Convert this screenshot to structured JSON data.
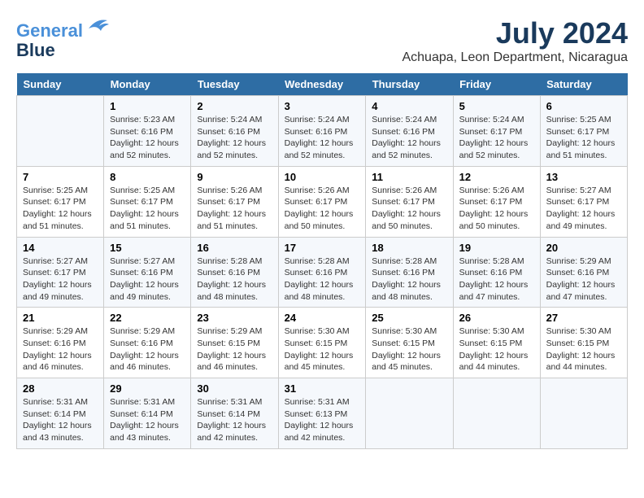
{
  "header": {
    "logo_line1": "General",
    "logo_line2": "Blue",
    "title": "July 2024",
    "subtitle": "Achuapa, Leon Department, Nicaragua"
  },
  "calendar": {
    "days_of_week": [
      "Sunday",
      "Monday",
      "Tuesday",
      "Wednesday",
      "Thursday",
      "Friday",
      "Saturday"
    ],
    "weeks": [
      [
        {
          "day": "",
          "info": ""
        },
        {
          "day": "1",
          "info": "Sunrise: 5:23 AM\nSunset: 6:16 PM\nDaylight: 12 hours\nand 52 minutes."
        },
        {
          "day": "2",
          "info": "Sunrise: 5:24 AM\nSunset: 6:16 PM\nDaylight: 12 hours\nand 52 minutes."
        },
        {
          "day": "3",
          "info": "Sunrise: 5:24 AM\nSunset: 6:16 PM\nDaylight: 12 hours\nand 52 minutes."
        },
        {
          "day": "4",
          "info": "Sunrise: 5:24 AM\nSunset: 6:16 PM\nDaylight: 12 hours\nand 52 minutes."
        },
        {
          "day": "5",
          "info": "Sunrise: 5:24 AM\nSunset: 6:17 PM\nDaylight: 12 hours\nand 52 minutes."
        },
        {
          "day": "6",
          "info": "Sunrise: 5:25 AM\nSunset: 6:17 PM\nDaylight: 12 hours\nand 51 minutes."
        }
      ],
      [
        {
          "day": "7",
          "info": "Sunrise: 5:25 AM\nSunset: 6:17 PM\nDaylight: 12 hours\nand 51 minutes."
        },
        {
          "day": "8",
          "info": "Sunrise: 5:25 AM\nSunset: 6:17 PM\nDaylight: 12 hours\nand 51 minutes."
        },
        {
          "day": "9",
          "info": "Sunrise: 5:26 AM\nSunset: 6:17 PM\nDaylight: 12 hours\nand 51 minutes."
        },
        {
          "day": "10",
          "info": "Sunrise: 5:26 AM\nSunset: 6:17 PM\nDaylight: 12 hours\nand 50 minutes."
        },
        {
          "day": "11",
          "info": "Sunrise: 5:26 AM\nSunset: 6:17 PM\nDaylight: 12 hours\nand 50 minutes."
        },
        {
          "day": "12",
          "info": "Sunrise: 5:26 AM\nSunset: 6:17 PM\nDaylight: 12 hours\nand 50 minutes."
        },
        {
          "day": "13",
          "info": "Sunrise: 5:27 AM\nSunset: 6:17 PM\nDaylight: 12 hours\nand 49 minutes."
        }
      ],
      [
        {
          "day": "14",
          "info": "Sunrise: 5:27 AM\nSunset: 6:17 PM\nDaylight: 12 hours\nand 49 minutes."
        },
        {
          "day": "15",
          "info": "Sunrise: 5:27 AM\nSunset: 6:16 PM\nDaylight: 12 hours\nand 49 minutes."
        },
        {
          "day": "16",
          "info": "Sunrise: 5:28 AM\nSunset: 6:16 PM\nDaylight: 12 hours\nand 48 minutes."
        },
        {
          "day": "17",
          "info": "Sunrise: 5:28 AM\nSunset: 6:16 PM\nDaylight: 12 hours\nand 48 minutes."
        },
        {
          "day": "18",
          "info": "Sunrise: 5:28 AM\nSunset: 6:16 PM\nDaylight: 12 hours\nand 48 minutes."
        },
        {
          "day": "19",
          "info": "Sunrise: 5:28 AM\nSunset: 6:16 PM\nDaylight: 12 hours\nand 47 minutes."
        },
        {
          "day": "20",
          "info": "Sunrise: 5:29 AM\nSunset: 6:16 PM\nDaylight: 12 hours\nand 47 minutes."
        }
      ],
      [
        {
          "day": "21",
          "info": "Sunrise: 5:29 AM\nSunset: 6:16 PM\nDaylight: 12 hours\nand 46 minutes."
        },
        {
          "day": "22",
          "info": "Sunrise: 5:29 AM\nSunset: 6:16 PM\nDaylight: 12 hours\nand 46 minutes."
        },
        {
          "day": "23",
          "info": "Sunrise: 5:29 AM\nSunset: 6:15 PM\nDaylight: 12 hours\nand 46 minutes."
        },
        {
          "day": "24",
          "info": "Sunrise: 5:30 AM\nSunset: 6:15 PM\nDaylight: 12 hours\nand 45 minutes."
        },
        {
          "day": "25",
          "info": "Sunrise: 5:30 AM\nSunset: 6:15 PM\nDaylight: 12 hours\nand 45 minutes."
        },
        {
          "day": "26",
          "info": "Sunrise: 5:30 AM\nSunset: 6:15 PM\nDaylight: 12 hours\nand 44 minutes."
        },
        {
          "day": "27",
          "info": "Sunrise: 5:30 AM\nSunset: 6:15 PM\nDaylight: 12 hours\nand 44 minutes."
        }
      ],
      [
        {
          "day": "28",
          "info": "Sunrise: 5:31 AM\nSunset: 6:14 PM\nDaylight: 12 hours\nand 43 minutes."
        },
        {
          "day": "29",
          "info": "Sunrise: 5:31 AM\nSunset: 6:14 PM\nDaylight: 12 hours\nand 43 minutes."
        },
        {
          "day": "30",
          "info": "Sunrise: 5:31 AM\nSunset: 6:14 PM\nDaylight: 12 hours\nand 42 minutes."
        },
        {
          "day": "31",
          "info": "Sunrise: 5:31 AM\nSunset: 6:13 PM\nDaylight: 12 hours\nand 42 minutes."
        },
        {
          "day": "",
          "info": ""
        },
        {
          "day": "",
          "info": ""
        },
        {
          "day": "",
          "info": ""
        }
      ]
    ]
  }
}
